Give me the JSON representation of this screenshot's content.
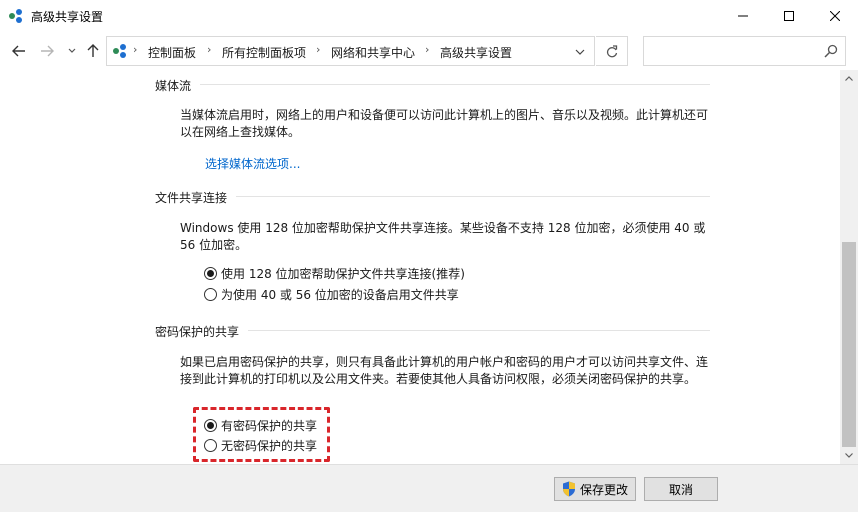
{
  "window": {
    "title": "高级共享设置"
  },
  "breadcrumb": {
    "items": [
      "控制面板",
      "所有控制面板项",
      "网络和共享中心",
      "高级共享设置"
    ],
    "separator": "›"
  },
  "search": {
    "placeholder": ""
  },
  "sections": {
    "media": {
      "heading": "媒体流",
      "description": "当媒体流启用时，网络上的用户和设备便可以访问此计算机上的图片、音乐以及视频。此计算机还可以在网络上查找媒体。",
      "link": "选择媒体流选项..."
    },
    "file_sharing": {
      "heading": "文件共享连接",
      "description": "Windows 使用 128 位加密帮助保护文件共享连接。某些设备不支持 128 位加密，必须使用 40 或 56 位加密。",
      "options": [
        {
          "label": "使用 128 位加密帮助保护文件共享连接(推荐)",
          "checked": true
        },
        {
          "label": "为使用 40 或 56 位加密的设备启用文件共享",
          "checked": false
        }
      ]
    },
    "password": {
      "heading": "密码保护的共享",
      "description": "如果已启用密码保护的共享，则只有具备此计算机的用户帐户和密码的用户才可以访问共享文件、连接到此计算机的打印机以及公用文件夹。若要使其他人具备访问权限，必须关闭密码保护的共享。",
      "options": [
        {
          "label": "有密码保护的共享",
          "checked": true
        },
        {
          "label": "无密码保护的共享",
          "checked": false
        }
      ]
    }
  },
  "footer": {
    "save_label": "保存更改",
    "cancel_label": "取消"
  },
  "colors": {
    "link": "#0066cc",
    "highlight": "#d9262b",
    "footer_bg": "#f0f0f0"
  },
  "icons": [
    "network-icon",
    "minimize-icon",
    "maximize-icon",
    "close-icon",
    "back-arrow-icon",
    "forward-arrow-icon",
    "chevron-down-icon",
    "up-arrow-icon",
    "refresh-icon",
    "search-icon",
    "shield-icon"
  ]
}
